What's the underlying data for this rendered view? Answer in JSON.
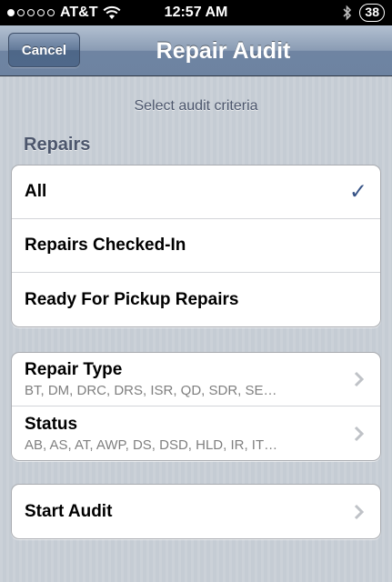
{
  "status_bar": {
    "carrier": "AT&T",
    "time": "12:57 AM",
    "battery": "38",
    "signal_filled": 1,
    "signal_total": 5
  },
  "nav": {
    "title": "Repair Audit",
    "cancel_label": "Cancel"
  },
  "subtitle": "Select audit criteria",
  "repairs_section": {
    "header": "Repairs",
    "items": [
      {
        "label": "All",
        "selected": true
      },
      {
        "label": "Repairs Checked-In",
        "selected": false
      },
      {
        "label": "Ready For Pickup Repairs",
        "selected": false
      }
    ]
  },
  "filters": {
    "repair_type": {
      "label": "Repair Type",
      "value": "BT, DM, DRC, DRS, ISR, QD, SDR, SE…"
    },
    "status": {
      "label": "Status",
      "value": "AB, AS, AT, AWP, DS, DSD, HLD, IR, IT…"
    }
  },
  "start_audit": {
    "label": "Start Audit"
  },
  "colors": {
    "nav_gradient_top": "#b3c0d1",
    "nav_gradient_bottom": "#6d83a1",
    "checkmark": "#385487",
    "background": "#c5ccd4"
  },
  "icons": {
    "check": "checkmark-icon",
    "disclosure": "chevron-right-icon",
    "wifi": "wifi-icon",
    "bluetooth": "bluetooth-icon"
  }
}
